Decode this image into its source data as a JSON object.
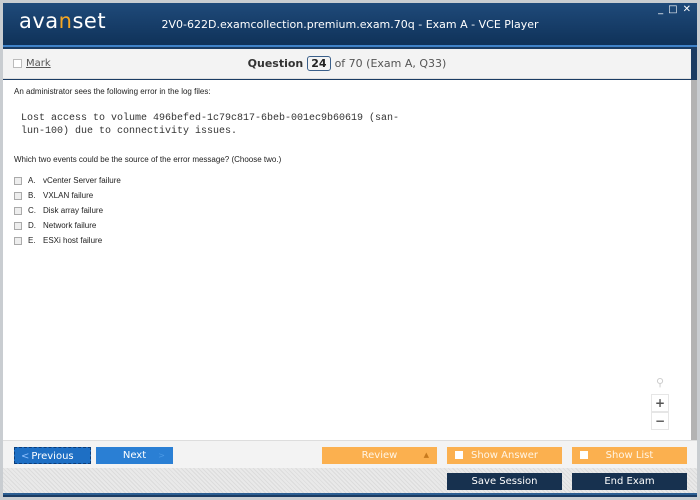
{
  "app": {
    "logo": {
      "pre": "ava",
      "accent": "n",
      "post": "set"
    },
    "window_title": "2V0-622D.examcollection.premium.exam.70q - Exam A - VCE Player",
    "window_controls": {
      "minimize": "_",
      "maximize": "□",
      "close": "✕"
    }
  },
  "question_bar": {
    "mark_label": "Mark",
    "question_label": "Question",
    "current": "24",
    "of_text": "of 70 (Exam A, Q33)"
  },
  "question": {
    "intro": "An administrator sees the following error in the log files:",
    "code_line1": "Lost access to volume 496befed-1c79c817-6beb-001ec9b60619 (san-",
    "code_line2": "lun-100) due to connectivity issues.",
    "ask": "Which two events could be the source of the error message? (Choose two.)",
    "options": [
      {
        "letter": "A.",
        "text": "vCenter Server failure",
        "checked": false
      },
      {
        "letter": "B.",
        "text": "VXLAN failure",
        "checked": false
      },
      {
        "letter": "C.",
        "text": "Disk array failure",
        "checked": false
      },
      {
        "letter": "D.",
        "text": "Network failure",
        "checked": false
      },
      {
        "letter": "E.",
        "text": "ESXi host failure",
        "checked": false
      }
    ]
  },
  "zoom_tools": {
    "search_icon": "⚲",
    "zoom_in": "+",
    "zoom_out": "−"
  },
  "nav": {
    "previous": "Previous",
    "next": "Next",
    "review": "Review",
    "show_answer": "Show Answer",
    "show_list": "Show List",
    "save_session": "Save Session",
    "end_exam": "End Exam"
  },
  "colors": {
    "brand_dark": "#0f3259",
    "accent_orange": "#fbb04f",
    "primary_blue": "#2a7fd4",
    "dark_button": "#17314f"
  }
}
